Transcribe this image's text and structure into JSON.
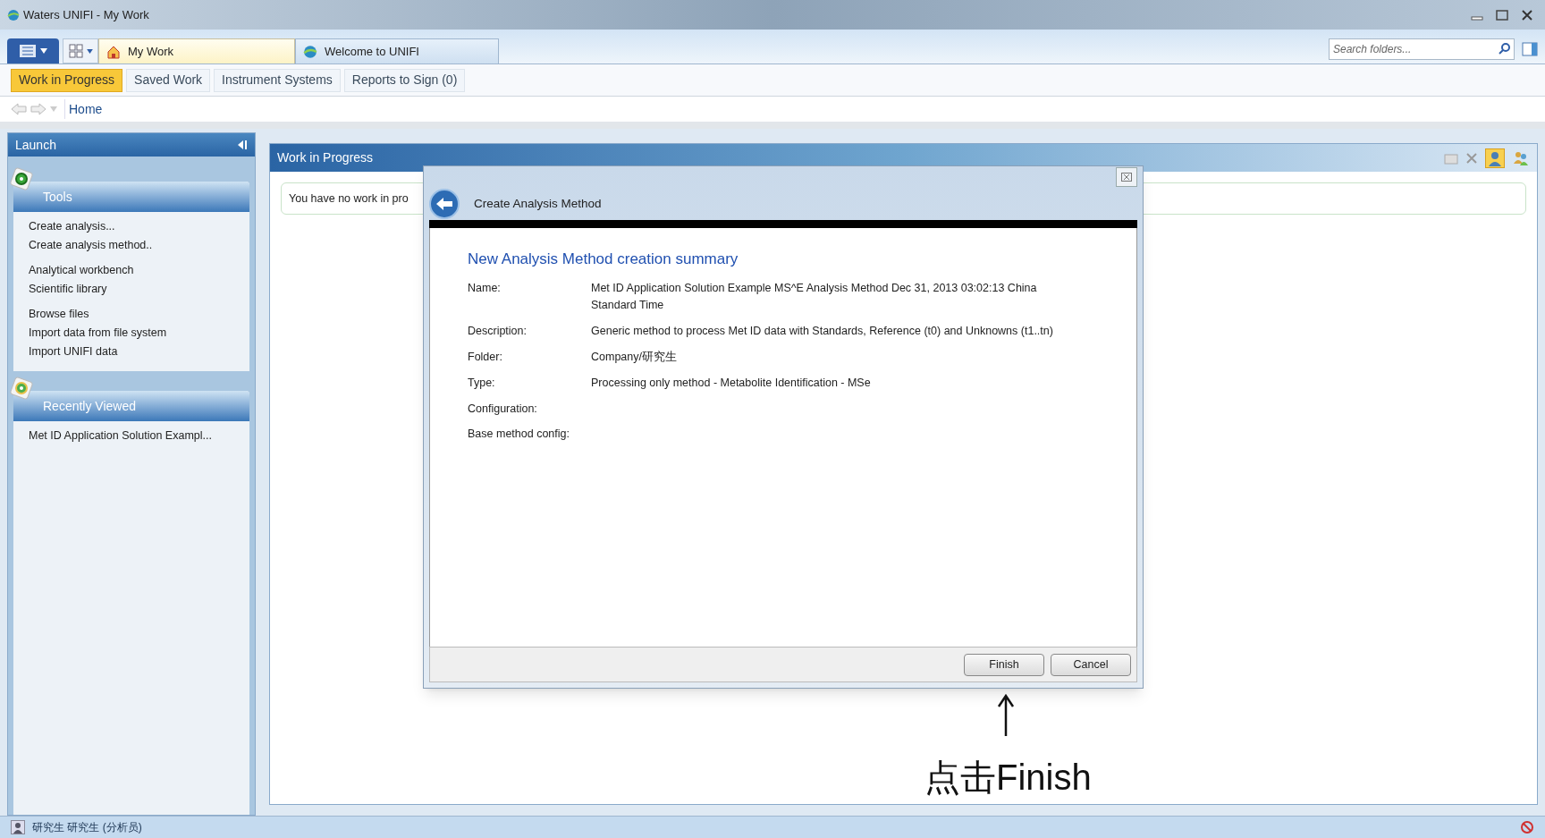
{
  "window": {
    "title": "Waters UNIFI - My Work"
  },
  "document_tabs": [
    {
      "label": "My Work",
      "selected": true
    },
    {
      "label": "Welcome to UNIFI",
      "selected": false
    }
  ],
  "search": {
    "placeholder": "Search folders..."
  },
  "nav_tabs": [
    {
      "label": "Work in Progress",
      "selected": true
    },
    {
      "label": "Saved Work",
      "selected": false
    },
    {
      "label": "Instrument Systems",
      "selected": false
    },
    {
      "label": "Reports to Sign (0)",
      "selected": false
    }
  ],
  "breadcrumb": "Home",
  "launch_panel": {
    "title": "Launch",
    "sections": [
      {
        "title": "Tools",
        "groups": [
          {
            "items": [
              "Create analysis...",
              "Create analysis method.."
            ]
          },
          {
            "items": [
              "Analytical workbench",
              "Scientific library"
            ]
          },
          {
            "items": [
              "Browse files",
              "Import data from file system",
              "Import UNIFI data"
            ]
          }
        ]
      },
      {
        "title": "Recently Viewed",
        "groups": [
          {
            "items": [
              "Met ID Application Solution Exampl..."
            ]
          }
        ]
      }
    ]
  },
  "work_panel": {
    "title": "Work in Progress",
    "message": "You have no work in pro"
  },
  "dialog": {
    "title": "Create Analysis Method",
    "heading": "New Analysis Method creation summary",
    "fields": [
      {
        "label": "Name:",
        "value": "Met ID Application Solution Example MS^E Analysis Method Dec 31, 2013 03:02:13 China Standard Time"
      },
      {
        "label": "Description:",
        "value": "Generic method to process Met ID data with Standards, Reference (t0) and Unknowns (t1..tn)"
      },
      {
        "label": "Folder:",
        "value": "Company/研究生"
      },
      {
        "label": "Type:",
        "value": "Processing only method - Metabolite Identification - MSe"
      },
      {
        "label": "Configuration:"
      },
      {
        "label": "Base method config:"
      }
    ],
    "buttons": [
      "Finish",
      "Cancel"
    ]
  },
  "annotation": {
    "text": "点击Finish"
  },
  "status_bar": {
    "user": "研究生 研究生 (分析员)"
  }
}
